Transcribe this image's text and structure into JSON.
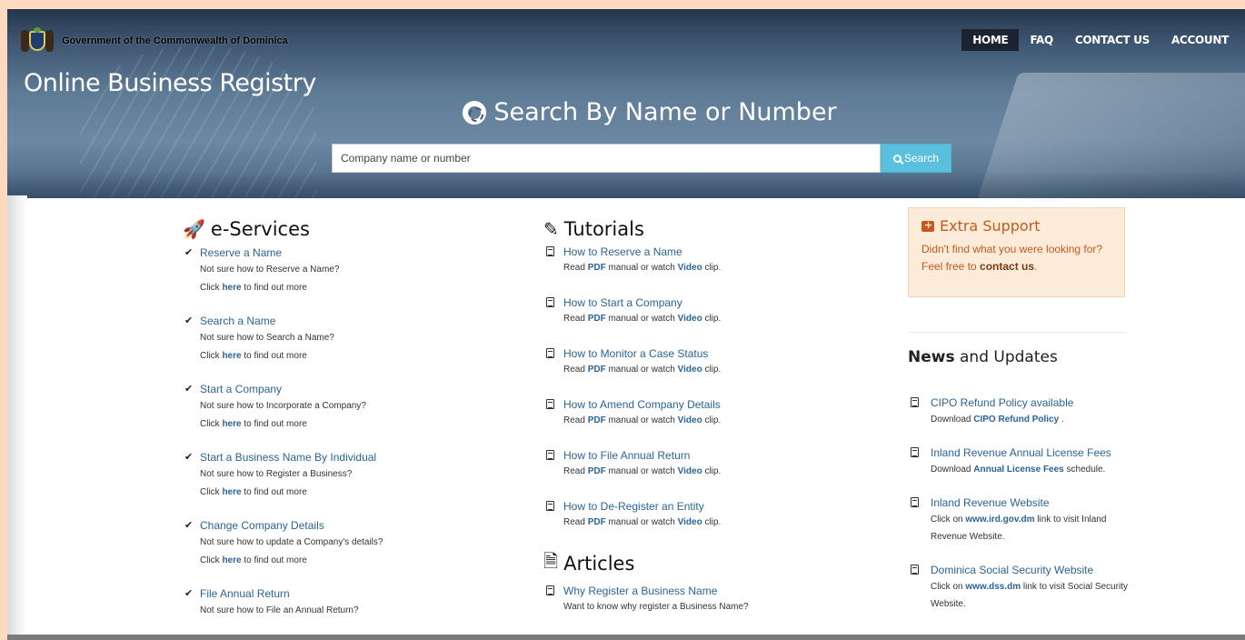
{
  "header": {
    "gov_name": "Government of the Commonwealth of Dominica",
    "site_title": "Online Business Registry",
    "nav": [
      {
        "label": "HOME",
        "active": true
      },
      {
        "label": "FAQ",
        "active": false
      },
      {
        "label": "CONTACT US",
        "active": false
      },
      {
        "label": "ACCOUNT",
        "active": false
      }
    ]
  },
  "search": {
    "title": "Search By Name or Number",
    "placeholder": "Company name or number",
    "button_label": "Search"
  },
  "eservices": {
    "title": "e-Services",
    "click_prefix": "Click",
    "click_link": "here",
    "click_suffix": "to find out more",
    "items": [
      {
        "label": "Reserve a Name",
        "desc": "Not sure how to Reserve a Name?"
      },
      {
        "label": "Search a Name",
        "desc": "Not sure how to Search a Name?"
      },
      {
        "label": "Start a Company",
        "desc": "Not sure how to Incorporate a Company?"
      },
      {
        "label": "Start a Business Name By Individual",
        "desc": "Not sure how to Register a Business?"
      },
      {
        "label": "Change Company Details",
        "desc": "Not sure how to update a Company's details?"
      },
      {
        "label": "File Annual Return",
        "desc": "Not sure how to File an Annual Return?"
      }
    ]
  },
  "tutorials": {
    "title": "Tutorials",
    "desc_prefix": "Read",
    "pdf": "PDF",
    "desc_mid": "manual or watch",
    "video": "Video",
    "desc_suffix": "clip.",
    "items": [
      {
        "label": "How to Reserve a Name"
      },
      {
        "label": "How to Start a Company"
      },
      {
        "label": "How to Monitor a Case Status"
      },
      {
        "label": "How to Amend Company Details"
      },
      {
        "label": "How to File Annual Return"
      },
      {
        "label": "How to De-Register an Entity"
      }
    ]
  },
  "articles": {
    "title": "Articles",
    "items": [
      {
        "label": "Why Register a Business Name",
        "desc": "Want to know why register a Business Name?"
      }
    ]
  },
  "support": {
    "title": "Extra Support",
    "text": "Didn't find what you were looking for? Feel free to",
    "link": "contact us",
    "suffix": "."
  },
  "news": {
    "title_bold": "News",
    "title_rest": "and Updates",
    "items": [
      {
        "label": "CIPO Refund Policy available",
        "prefix": "Download",
        "link": "CIPO Refund Policy",
        "suffix": "."
      },
      {
        "label": "Inland Revenue Annual License Fees",
        "prefix": "Download",
        "link": "Annual License Fees",
        "suffix": "schedule."
      },
      {
        "label": "Inland Revenue Website",
        "prefix": "Click on",
        "link": "www.ird.gov.dm",
        "suffix": "link to visit Inland Revenue Website."
      },
      {
        "label": "Dominica Social Security Website",
        "prefix": "Click on",
        "link": "www.dss.dm",
        "suffix": "link to visit Social Security Website."
      }
    ]
  },
  "colors": {
    "link": "#2a6496",
    "support_accent": "#c45a1e",
    "search_button": "#5bc0de",
    "page_border": "#fcd9bf"
  }
}
